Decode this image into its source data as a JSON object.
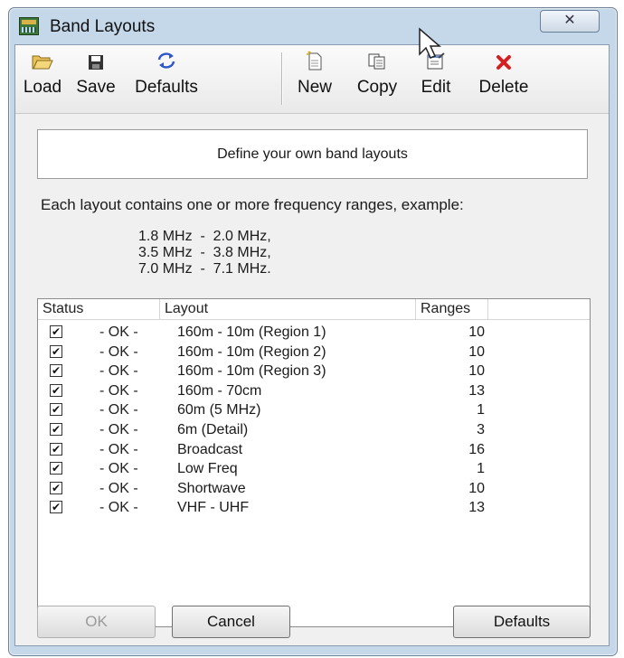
{
  "window": {
    "title": "Band Layouts",
    "close_glyph": "✕"
  },
  "toolbar": {
    "load": "Load",
    "save": "Save",
    "defaults": "Defaults",
    "new": "New",
    "copy": "Copy",
    "edit": "Edit",
    "delete": "Delete"
  },
  "banner": "Define your own band layouts",
  "description": "Each layout contains one or more frequency ranges, example:",
  "examples": "1.8 MHz  -  2.0 MHz,\n3.5 MHz  -  3.8 MHz,\n7.0 MHz  -  7.1 MHz.",
  "table": {
    "headers": {
      "status": "Status",
      "layout": "Layout",
      "ranges": "Ranges"
    },
    "rows": [
      {
        "status": "- OK -",
        "layout": "160m - 10m (Region 1)",
        "ranges": "10"
      },
      {
        "status": "- OK -",
        "layout": "160m - 10m (Region 2)",
        "ranges": "10"
      },
      {
        "status": "- OK -",
        "layout": "160m - 10m (Region 3)",
        "ranges": "10"
      },
      {
        "status": "- OK -",
        "layout": "160m - 70cm",
        "ranges": "13"
      },
      {
        "status": "- OK -",
        "layout": "60m (5 MHz)",
        "ranges": "1"
      },
      {
        "status": "- OK -",
        "layout": "6m (Detail)",
        "ranges": "3"
      },
      {
        "status": "- OK -",
        "layout": "Broadcast",
        "ranges": "16"
      },
      {
        "status": "- OK -",
        "layout": "Low Freq",
        "ranges": "1"
      },
      {
        "status": "- OK -",
        "layout": "Shortwave",
        "ranges": "10"
      },
      {
        "status": "- OK -",
        "layout": "VHF - UHF",
        "ranges": "13"
      }
    ]
  },
  "buttons": {
    "ok": "OK",
    "cancel": "Cancel",
    "defaults": "Defaults"
  },
  "colors": {
    "title_bar": "#c5d8ea",
    "client": "#f0f0f0",
    "delete_icon": "#d42020"
  }
}
